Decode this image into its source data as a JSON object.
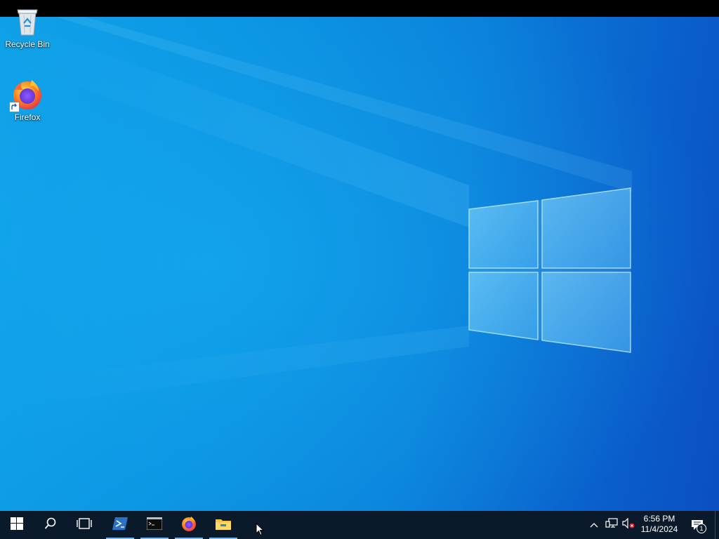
{
  "desktop": {
    "icons": [
      {
        "label": "Recycle Bin",
        "icon": "recycle-bin-icon"
      },
      {
        "label": "Firefox",
        "icon": "firefox-icon"
      }
    ]
  },
  "taskbar": {
    "start": {
      "icon": "windows-start-icon"
    },
    "search": {
      "icon": "search-icon"
    },
    "task_view": {
      "icon": "task-view-icon"
    },
    "pinned": [
      {
        "icon": "powershell-icon",
        "active": true
      },
      {
        "icon": "command-prompt-icon",
        "active": true
      },
      {
        "icon": "firefox-icon",
        "active": true
      },
      {
        "icon": "file-explorer-icon",
        "active": true
      }
    ],
    "tray": {
      "chevron": "chevron-up-icon",
      "network": "network-icon",
      "volume": "volume-muted-icon"
    },
    "clock": {
      "time": "6:56 PM",
      "date": "11/4/2024"
    },
    "notifications": {
      "icon": "action-center-icon",
      "count": "1"
    }
  },
  "colors": {
    "taskbar": "#0b1a2b",
    "active_indicator": "#76b9ed",
    "wallpaper_light": "#0d9fe6",
    "wallpaper_dark": "#0b4fc2"
  }
}
